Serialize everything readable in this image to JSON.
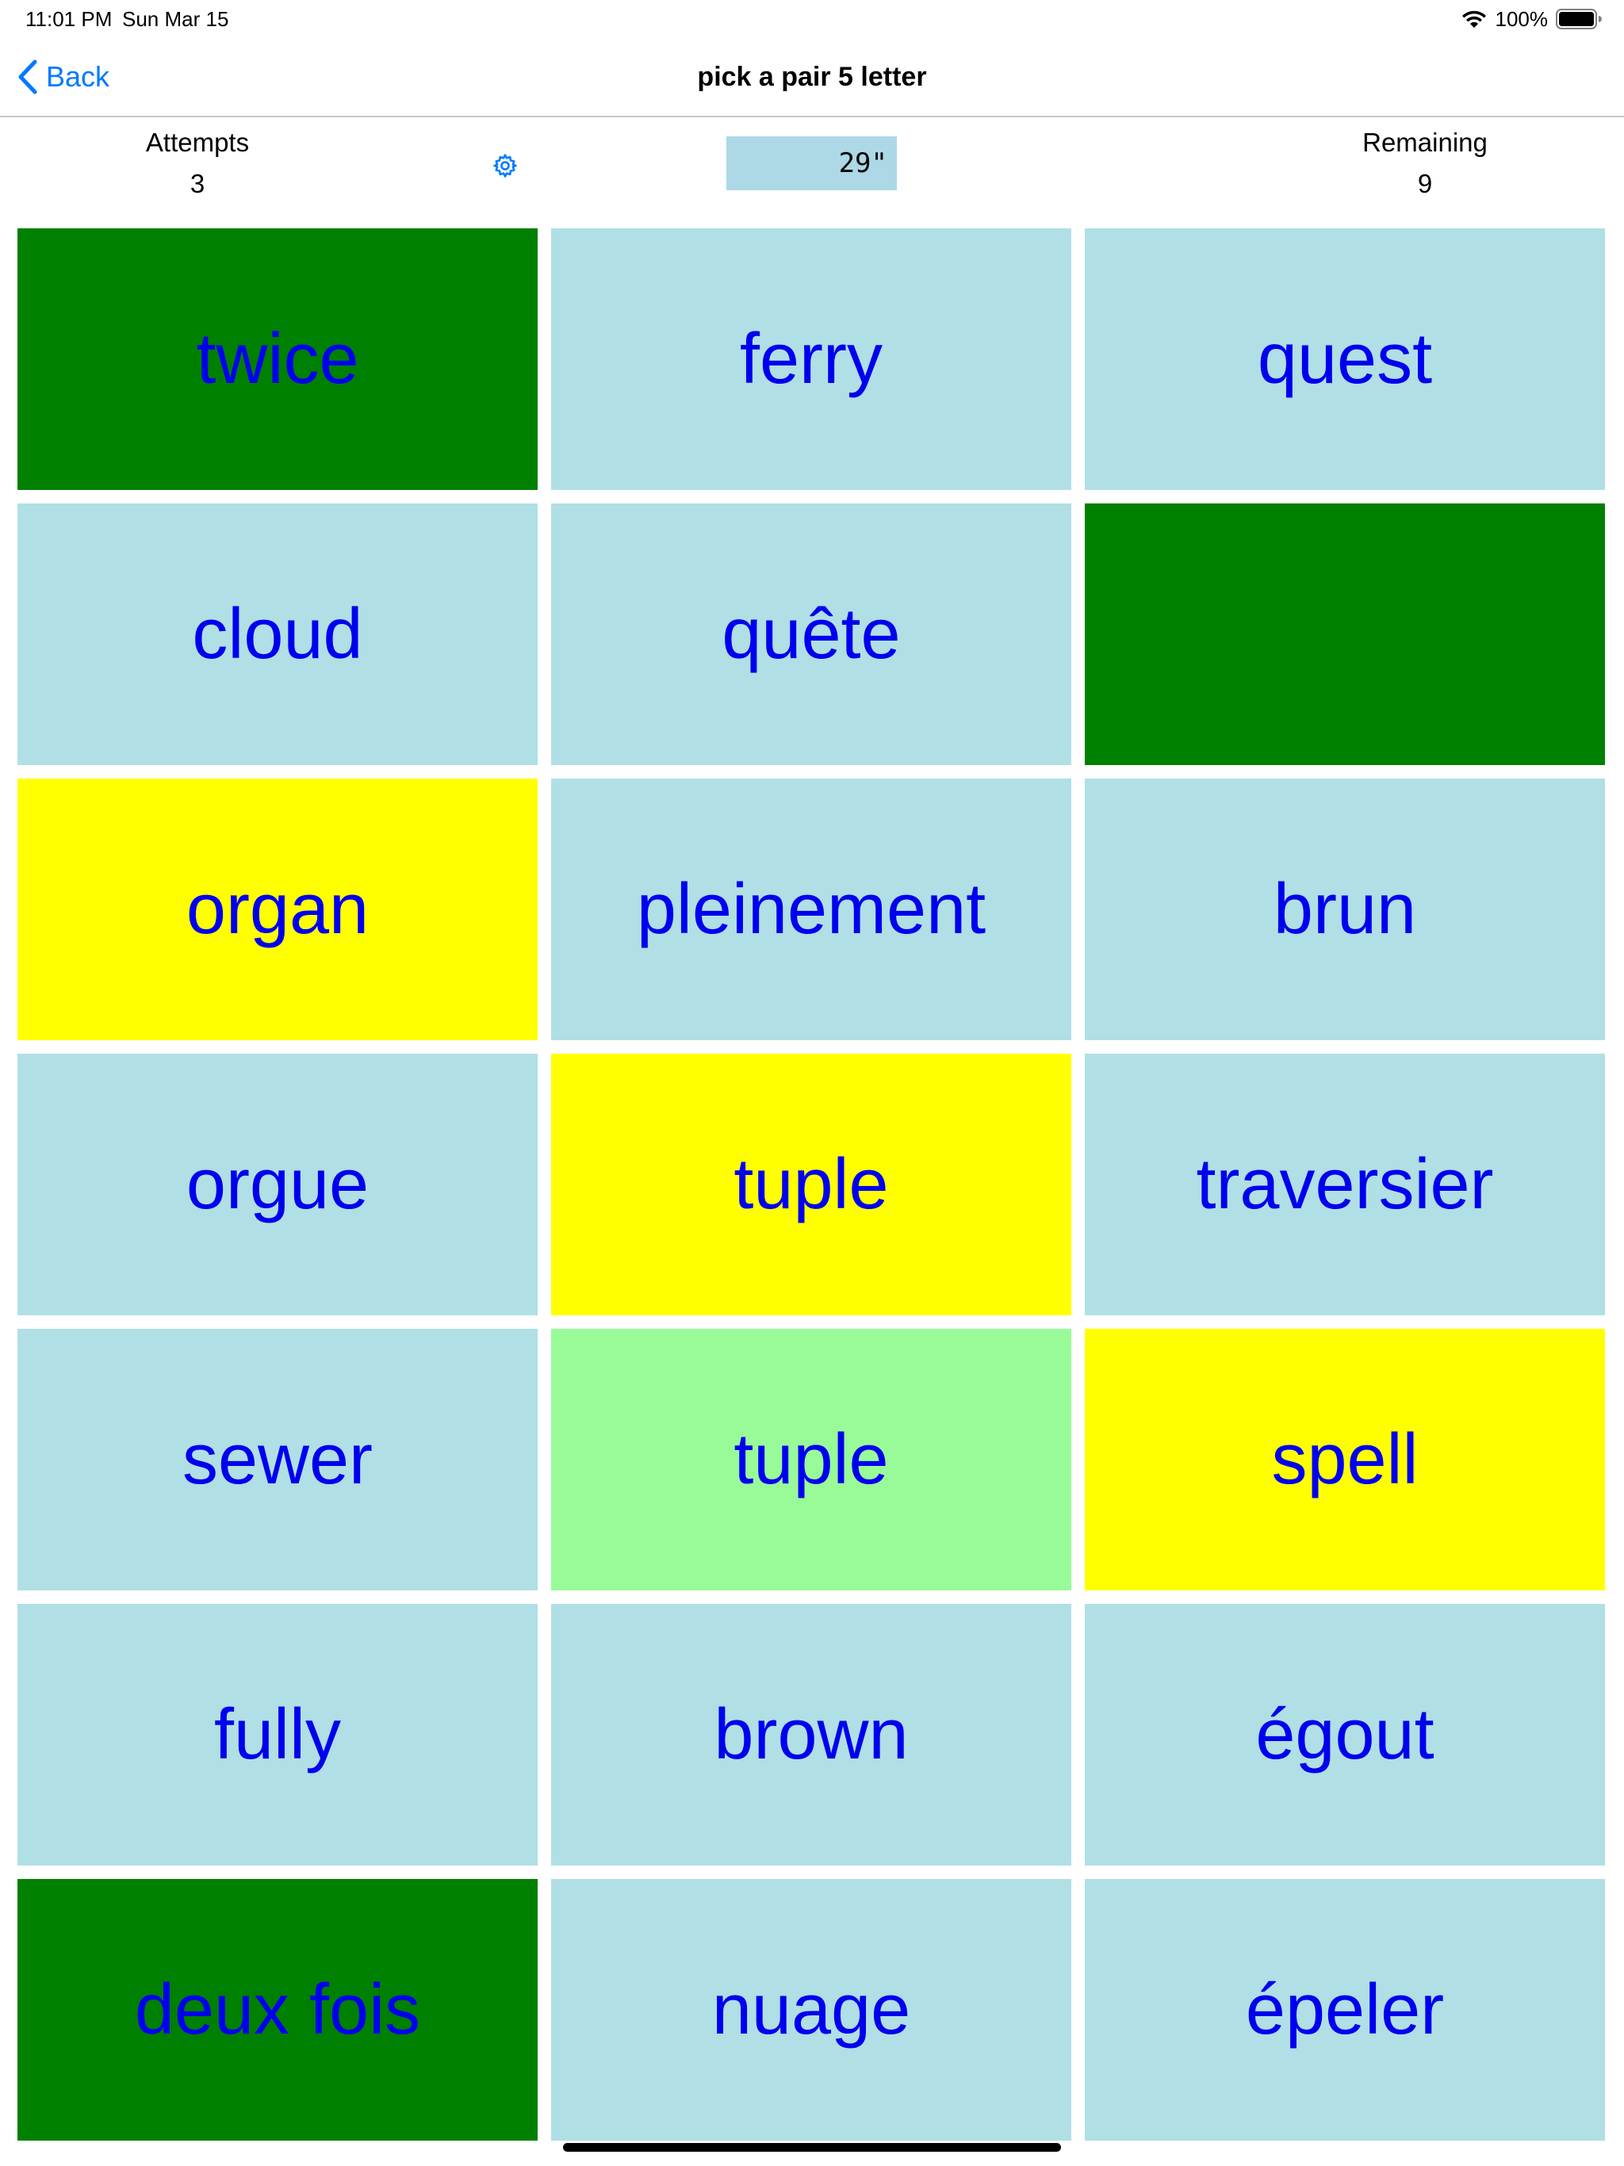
{
  "status_bar": {
    "time": "11:01 PM",
    "date": "Sun Mar 15",
    "battery": "100%",
    "icons": [
      "wifi-icon",
      "battery-icon"
    ]
  },
  "nav": {
    "back_label": "Back",
    "title": "pick a pair 5 letter",
    "icons": [
      "chevron-left-icon"
    ]
  },
  "stats": {
    "attempts_label": "Attempts",
    "attempts_value": "3",
    "remaining_label": "Remaining",
    "remaining_value": "9",
    "timer": "29\"",
    "icons": [
      "gear-icon"
    ]
  },
  "colors": {
    "card_default": "#b0dfe5",
    "card_matched": "#008000",
    "card_selected": "#ffff00",
    "card_hint": "#98fb98",
    "card_text": "#0000ee",
    "accent": "#007aff",
    "timer_bg": "#add8e6"
  },
  "cards": [
    {
      "word": "twice",
      "state": "matched"
    },
    {
      "word": "ferry",
      "state": "default"
    },
    {
      "word": "quest",
      "state": "default"
    },
    {
      "word": "cloud",
      "state": "default"
    },
    {
      "word": "quête",
      "state": "default"
    },
    {
      "word": "",
      "state": "matched"
    },
    {
      "word": "organ",
      "state": "selected"
    },
    {
      "word": "pleinement",
      "state": "default"
    },
    {
      "word": "brun",
      "state": "default"
    },
    {
      "word": "orgue",
      "state": "default"
    },
    {
      "word": "tuple",
      "state": "selected"
    },
    {
      "word": "traversier",
      "state": "default"
    },
    {
      "word": "sewer",
      "state": "default"
    },
    {
      "word": "tuple",
      "state": "hint"
    },
    {
      "word": "spell",
      "state": "selected"
    },
    {
      "word": "fully",
      "state": "default"
    },
    {
      "word": "brown",
      "state": "default"
    },
    {
      "word": "égout",
      "state": "default"
    },
    {
      "word": "deux fois",
      "state": "matched"
    },
    {
      "word": "nuage",
      "state": "default"
    },
    {
      "word": "épeler",
      "state": "default"
    }
  ]
}
